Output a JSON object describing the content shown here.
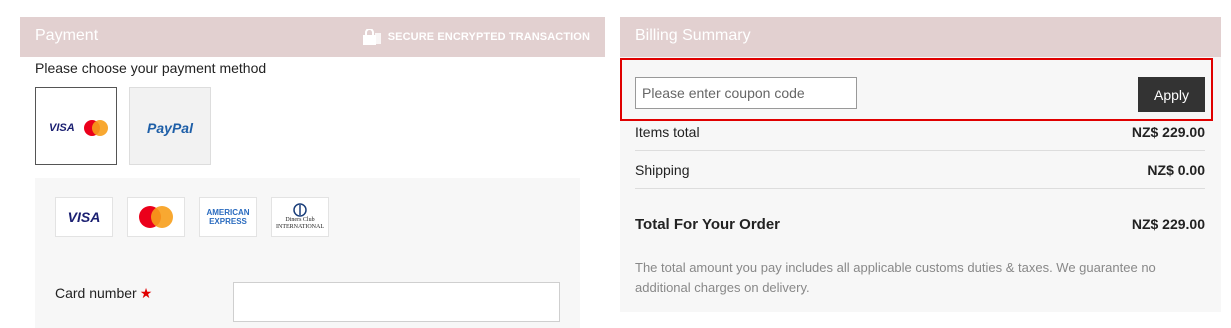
{
  "payment": {
    "title": "Payment",
    "secure_text": "SECURE ENCRYPTED TRANSACTION",
    "choose_text": "Please choose your payment method",
    "methods": [
      {
        "label": "VISA",
        "icon": "visa-mastercard-icon"
      },
      {
        "label": "PayPal",
        "icon": "paypal-icon"
      }
    ],
    "card_logos": [
      "VISA",
      "MasterCard",
      "AMERICAN EXPRESS",
      "Diners Club INTERNATIONAL"
    ],
    "card_number_label": "Card number",
    "required_mark": "★",
    "card_number_value": ""
  },
  "billing": {
    "title": "Billing Summary",
    "coupon_placeholder": "Please enter coupon code",
    "apply_label": "Apply",
    "items_total_label": "Items total",
    "items_total_value": "NZ$ 229.00",
    "shipping_label": "Shipping",
    "shipping_value": "NZ$ 0.00",
    "total_label": "Total For Your Order",
    "total_value": "NZ$ 229.00",
    "note": "The total amount you pay includes all applicable customs duties & taxes. We guarantee no additional charges on delivery."
  },
  "colors": {
    "header_bg": "#e2d0d0",
    "highlight_border": "#e00000",
    "apply_bg": "#333333"
  }
}
